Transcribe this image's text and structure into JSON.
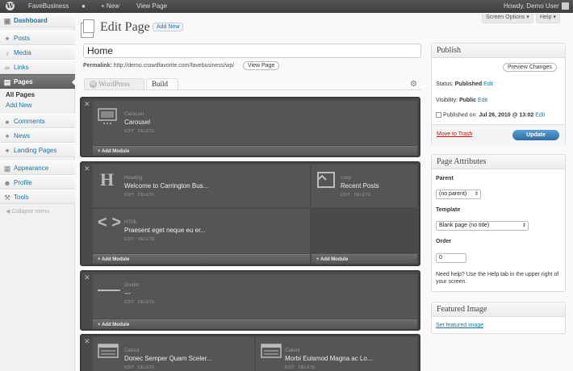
{
  "adminbar": {
    "site_name": "FaveBusiness",
    "new_label": "New",
    "view_page_label": "View Page",
    "howdy": "Howdy, Demo User"
  },
  "sidebar": {
    "items": [
      {
        "label": "Dashboard",
        "icon": "dashboard-icon"
      },
      {
        "label": "Posts",
        "icon": "pushpin-icon"
      },
      {
        "label": "Media",
        "icon": "media-icon"
      },
      {
        "label": "Links",
        "icon": "link-icon"
      },
      {
        "label": "Pages",
        "icon": "pages-icon"
      },
      {
        "label": "Comments",
        "icon": "comment-icon"
      },
      {
        "label": "News",
        "icon": "pushpin-icon"
      },
      {
        "label": "Landing Pages",
        "icon": "pushpin-icon"
      },
      {
        "label": "Appearance",
        "icon": "appearance-icon"
      },
      {
        "label": "Profile",
        "icon": "profile-icon"
      },
      {
        "label": "Tools",
        "icon": "tools-icon"
      }
    ],
    "submenu": [
      "All Pages",
      "Add New"
    ],
    "collapse": "Collapse menu"
  },
  "header": {
    "title": "Edit Page",
    "add_new": "Add New",
    "screen_options": "Screen Options",
    "help": "Help"
  },
  "editor": {
    "post_title": "Home",
    "permalink_label": "Permalink:",
    "permalink_url": "http://demo.crowdfavorite.com/favebusiness/wp/",
    "view_page_button": "View Page",
    "tabs": [
      "WordPress",
      "Build"
    ]
  },
  "builder": {
    "actions": [
      "EDIT",
      "DELETE"
    ],
    "add_module": "Add Module",
    "modules": [
      {
        "type": "Carousel",
        "title": "Carousel"
      },
      {
        "type": "Heading",
        "title": "Welcome to Carrington Bus..."
      },
      {
        "type": "Loop",
        "title": "Recent Posts"
      },
      {
        "type": "HTML",
        "title": "Praesent eget neque eu er..."
      },
      {
        "type": "Divider",
        "title": "---"
      },
      {
        "type": "Callout",
        "title": "Donec Semper Quam Sceler..."
      },
      {
        "type": "Callout",
        "title": "Morbi Euismod Magna ac Lo..."
      }
    ]
  },
  "publish": {
    "title": "Publish",
    "preview": "Preview Changes",
    "status_label": "Status:",
    "status_value": "Published",
    "edit": "Edit",
    "visibility_label": "Visibility:",
    "visibility_value": "Public",
    "published_on_label": "Published on:",
    "published_on_value": "Jul 26, 2010 @ 13:02",
    "trash": "Move to Trash",
    "update": "Update"
  },
  "page_attributes": {
    "title": "Page Attributes",
    "parent_label": "Parent",
    "parent_value": "(no parent)",
    "template_label": "Template",
    "template_value": "Blank page (no title)",
    "order_label": "Order",
    "order_value": "0",
    "help_text": "Need help? Use the Help tab in the upper right of your screen."
  },
  "featured_image": {
    "title": "Featured Image",
    "link": "Set featured image"
  },
  "colors": {
    "link": "#21759b",
    "update_button": "#2e6da4",
    "trash": "#bc0b0b",
    "builder_bg": "#4a4a4a"
  }
}
